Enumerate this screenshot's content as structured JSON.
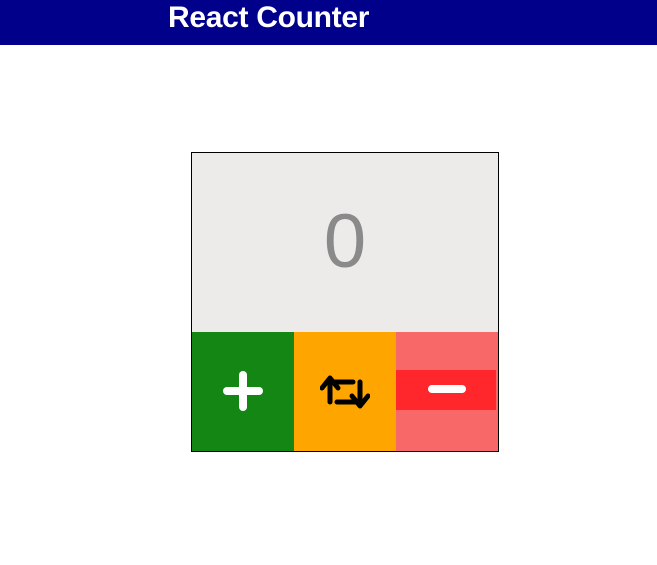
{
  "header": {
    "title": "React Counter",
    "background": "#00008b"
  },
  "counter": {
    "value": "0",
    "display_background": "#ecebe9"
  },
  "buttons": {
    "increment": {
      "icon": "plus-icon",
      "color": "#138614"
    },
    "reset": {
      "icon": "repeat-icon",
      "color": "#ffa500"
    },
    "decrement": {
      "icon": "minus-icon",
      "color": "#f86868",
      "band_color": "#ff272b"
    }
  }
}
